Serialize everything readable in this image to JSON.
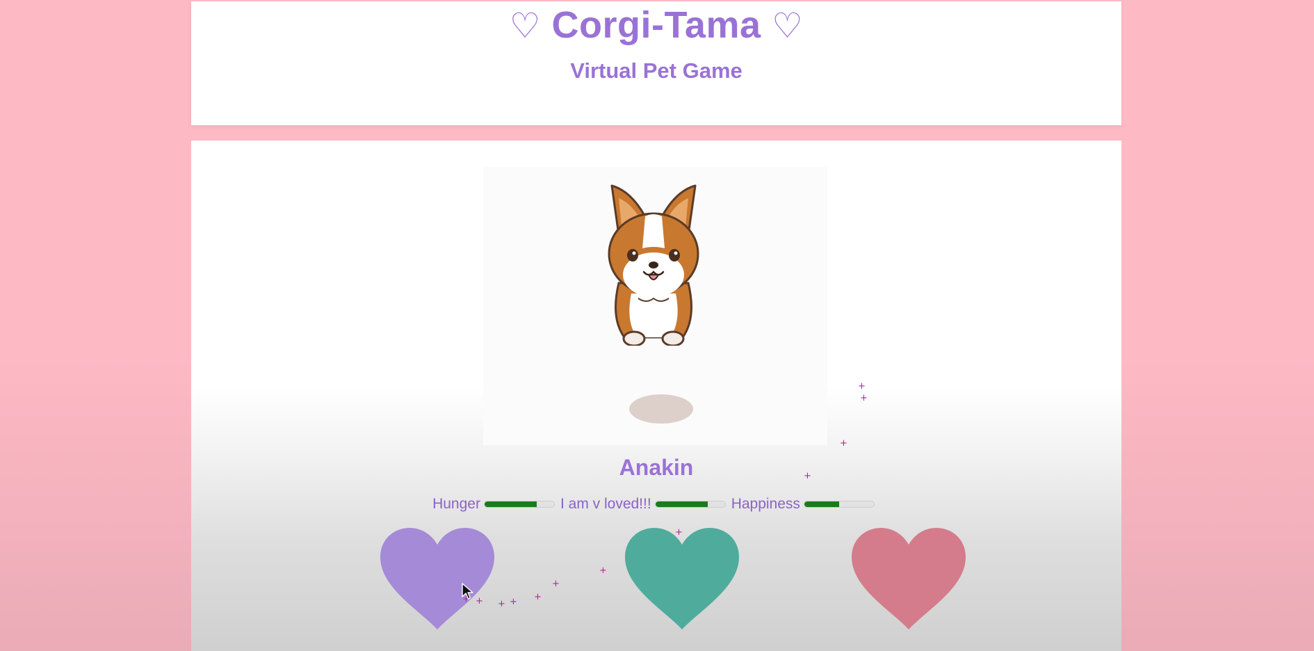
{
  "header": {
    "title": "Corgi-Tama",
    "title_heart": "♡",
    "subtitle": "Virtual Pet Game"
  },
  "pet": {
    "name": "Anakin",
    "image": "corgi-puppy",
    "bowl": "food-bowl-empty"
  },
  "stats": [
    {
      "label": "Hunger",
      "level": 0.75
    },
    {
      "label": "I am v loved!!!",
      "level": 0.75
    },
    {
      "label": "Happiness",
      "level": 0.5
    }
  ],
  "actions": [
    {
      "icon": "heart-icon",
      "color": "#a58ad8"
    },
    {
      "icon": "heart-icon",
      "color": "#4fac9c"
    },
    {
      "icon": "heart-icon",
      "color": "#d47c8c"
    }
  ],
  "colors": {
    "background": "#fdb9c4",
    "accent": "#9a72d6",
    "bar_fill": "#1b7a1d",
    "sparkle": "#a8289b"
  }
}
